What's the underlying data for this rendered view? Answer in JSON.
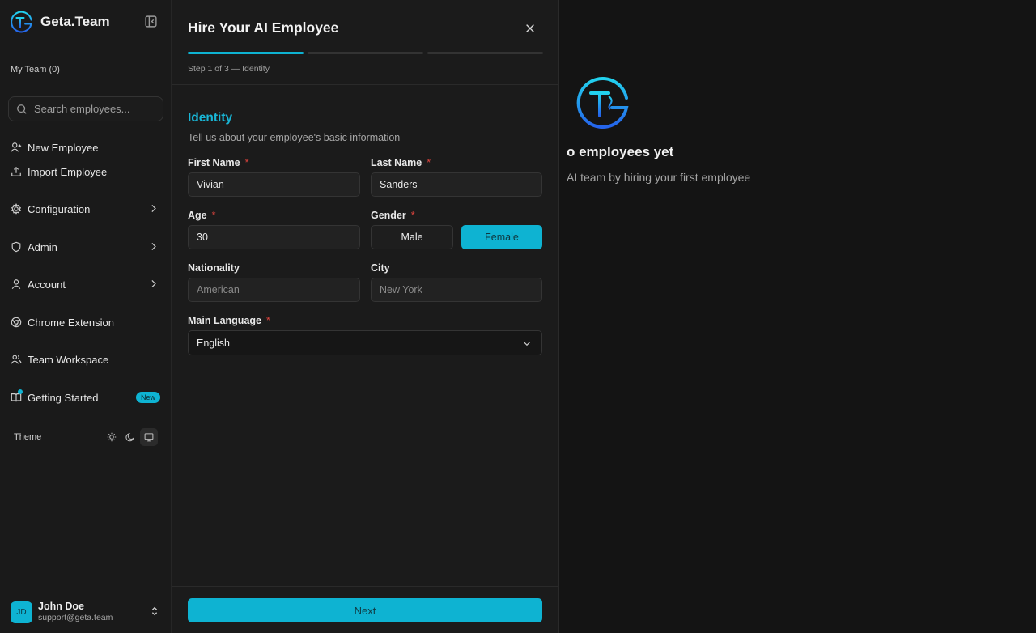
{
  "sidebar": {
    "brand": "Geta.Team",
    "my_team": "My Team (0)",
    "search_placeholder": "Search employees...",
    "items": [
      {
        "label": "New Employee"
      },
      {
        "label": "Import Employee"
      },
      {
        "label": "Configuration"
      },
      {
        "label": "Admin"
      },
      {
        "label": "Account"
      },
      {
        "label": "Chrome Extension"
      },
      {
        "label": "Team Workspace"
      },
      {
        "label": "Getting Started",
        "badge": "New"
      }
    ],
    "theme_label": "Theme",
    "user": {
      "initials": "JD",
      "name": "John Doe",
      "email": "support@geta.team"
    }
  },
  "background": {
    "empty_title": "o employees yet",
    "empty_sub": "AI team by hiring your first employee"
  },
  "modal": {
    "title": "Hire Your AI Employee",
    "step_text": "Step 1 of 3 — Identity",
    "step_progress": 0.333,
    "section_title": "Identity",
    "section_sub": "Tell us about your employee's basic information",
    "first_name": {
      "label": "First Name",
      "value": "Vivian"
    },
    "last_name": {
      "label": "Last Name",
      "value": "Sanders"
    },
    "age": {
      "label": "Age",
      "value": "30"
    },
    "gender": {
      "label": "Gender",
      "options": [
        "Male",
        "Female"
      ],
      "selected": "Female"
    },
    "nationality": {
      "label": "Nationality",
      "placeholder": "American"
    },
    "city": {
      "label": "City",
      "placeholder": "New York"
    },
    "main_language": {
      "label": "Main Language",
      "value": "English"
    },
    "required_mark": "*",
    "next_label": "Next"
  },
  "colors": {
    "accent": "#0eb3d2",
    "background": "#141414",
    "panel": "#1b1b1b",
    "required": "#e0443e"
  }
}
